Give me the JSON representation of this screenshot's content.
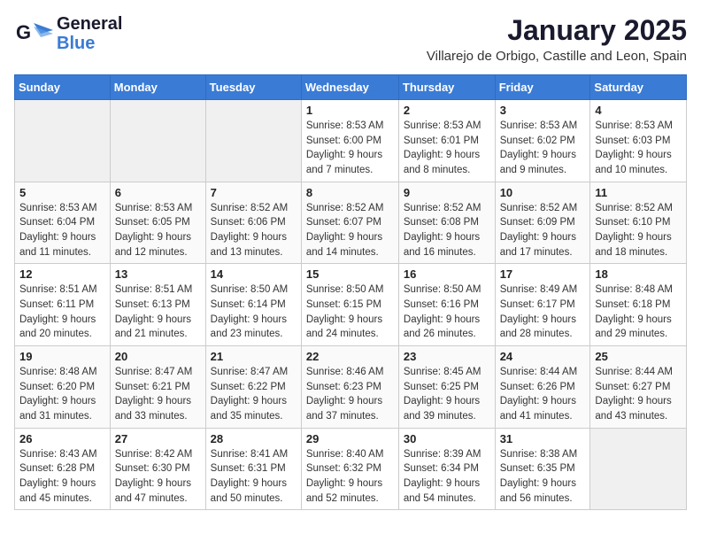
{
  "header": {
    "logo_line1": "General",
    "logo_line2": "Blue",
    "month": "January 2025",
    "location": "Villarejo de Orbigo, Castille and Leon, Spain"
  },
  "weekdays": [
    "Sunday",
    "Monday",
    "Tuesday",
    "Wednesday",
    "Thursday",
    "Friday",
    "Saturday"
  ],
  "weeks": [
    [
      {
        "day": "",
        "info": ""
      },
      {
        "day": "",
        "info": ""
      },
      {
        "day": "",
        "info": ""
      },
      {
        "day": "1",
        "info": "Sunrise: 8:53 AM\nSunset: 6:00 PM\nDaylight: 9 hours\nand 7 minutes."
      },
      {
        "day": "2",
        "info": "Sunrise: 8:53 AM\nSunset: 6:01 PM\nDaylight: 9 hours\nand 8 minutes."
      },
      {
        "day": "3",
        "info": "Sunrise: 8:53 AM\nSunset: 6:02 PM\nDaylight: 9 hours\nand 9 minutes."
      },
      {
        "day": "4",
        "info": "Sunrise: 8:53 AM\nSunset: 6:03 PM\nDaylight: 9 hours\nand 10 minutes."
      }
    ],
    [
      {
        "day": "5",
        "info": "Sunrise: 8:53 AM\nSunset: 6:04 PM\nDaylight: 9 hours\nand 11 minutes."
      },
      {
        "day": "6",
        "info": "Sunrise: 8:53 AM\nSunset: 6:05 PM\nDaylight: 9 hours\nand 12 minutes."
      },
      {
        "day": "7",
        "info": "Sunrise: 8:52 AM\nSunset: 6:06 PM\nDaylight: 9 hours\nand 13 minutes."
      },
      {
        "day": "8",
        "info": "Sunrise: 8:52 AM\nSunset: 6:07 PM\nDaylight: 9 hours\nand 14 minutes."
      },
      {
        "day": "9",
        "info": "Sunrise: 8:52 AM\nSunset: 6:08 PM\nDaylight: 9 hours\nand 16 minutes."
      },
      {
        "day": "10",
        "info": "Sunrise: 8:52 AM\nSunset: 6:09 PM\nDaylight: 9 hours\nand 17 minutes."
      },
      {
        "day": "11",
        "info": "Sunrise: 8:52 AM\nSunset: 6:10 PM\nDaylight: 9 hours\nand 18 minutes."
      }
    ],
    [
      {
        "day": "12",
        "info": "Sunrise: 8:51 AM\nSunset: 6:11 PM\nDaylight: 9 hours\nand 20 minutes."
      },
      {
        "day": "13",
        "info": "Sunrise: 8:51 AM\nSunset: 6:13 PM\nDaylight: 9 hours\nand 21 minutes."
      },
      {
        "day": "14",
        "info": "Sunrise: 8:50 AM\nSunset: 6:14 PM\nDaylight: 9 hours\nand 23 minutes."
      },
      {
        "day": "15",
        "info": "Sunrise: 8:50 AM\nSunset: 6:15 PM\nDaylight: 9 hours\nand 24 minutes."
      },
      {
        "day": "16",
        "info": "Sunrise: 8:50 AM\nSunset: 6:16 PM\nDaylight: 9 hours\nand 26 minutes."
      },
      {
        "day": "17",
        "info": "Sunrise: 8:49 AM\nSunset: 6:17 PM\nDaylight: 9 hours\nand 28 minutes."
      },
      {
        "day": "18",
        "info": "Sunrise: 8:48 AM\nSunset: 6:18 PM\nDaylight: 9 hours\nand 29 minutes."
      }
    ],
    [
      {
        "day": "19",
        "info": "Sunrise: 8:48 AM\nSunset: 6:20 PM\nDaylight: 9 hours\nand 31 minutes."
      },
      {
        "day": "20",
        "info": "Sunrise: 8:47 AM\nSunset: 6:21 PM\nDaylight: 9 hours\nand 33 minutes."
      },
      {
        "day": "21",
        "info": "Sunrise: 8:47 AM\nSunset: 6:22 PM\nDaylight: 9 hours\nand 35 minutes."
      },
      {
        "day": "22",
        "info": "Sunrise: 8:46 AM\nSunset: 6:23 PM\nDaylight: 9 hours\nand 37 minutes."
      },
      {
        "day": "23",
        "info": "Sunrise: 8:45 AM\nSunset: 6:25 PM\nDaylight: 9 hours\nand 39 minutes."
      },
      {
        "day": "24",
        "info": "Sunrise: 8:44 AM\nSunset: 6:26 PM\nDaylight: 9 hours\nand 41 minutes."
      },
      {
        "day": "25",
        "info": "Sunrise: 8:44 AM\nSunset: 6:27 PM\nDaylight: 9 hours\nand 43 minutes."
      }
    ],
    [
      {
        "day": "26",
        "info": "Sunrise: 8:43 AM\nSunset: 6:28 PM\nDaylight: 9 hours\nand 45 minutes."
      },
      {
        "day": "27",
        "info": "Sunrise: 8:42 AM\nSunset: 6:30 PM\nDaylight: 9 hours\nand 47 minutes."
      },
      {
        "day": "28",
        "info": "Sunrise: 8:41 AM\nSunset: 6:31 PM\nDaylight: 9 hours\nand 50 minutes."
      },
      {
        "day": "29",
        "info": "Sunrise: 8:40 AM\nSunset: 6:32 PM\nDaylight: 9 hours\nand 52 minutes."
      },
      {
        "day": "30",
        "info": "Sunrise: 8:39 AM\nSunset: 6:34 PM\nDaylight: 9 hours\nand 54 minutes."
      },
      {
        "day": "31",
        "info": "Sunrise: 8:38 AM\nSunset: 6:35 PM\nDaylight: 9 hours\nand 56 minutes."
      },
      {
        "day": "",
        "info": ""
      }
    ]
  ]
}
